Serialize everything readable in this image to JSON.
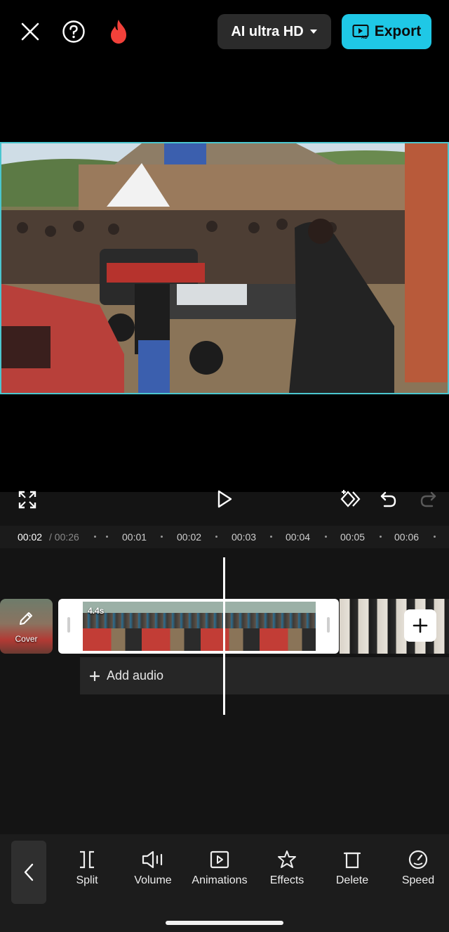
{
  "topbar": {
    "close_icon": "close-icon",
    "help_icon": "help-icon",
    "fire_icon": "fire-icon",
    "quality_label": "AI ultra HD",
    "export_label": "Export",
    "colors": {
      "export_bg": "#1fc8e6",
      "fire": "#f2413a"
    }
  },
  "controls": {
    "fullscreen_icon": "fullscreen-icon",
    "play_icon": "play-icon",
    "keyframe_icon": "add-keyframe-icon",
    "undo_icon": "undo-icon",
    "redo_icon": "redo-icon"
  },
  "ruler": {
    "current_time": "00:02",
    "total_time": "/ 00:26",
    "ticks": [
      "00:01",
      "00:02",
      "00:03",
      "00:04",
      "00:05",
      "00:06"
    ]
  },
  "timeline": {
    "cover_label": "Cover",
    "clip_duration": "4.4s",
    "add_audio_label": "Add audio"
  },
  "toolbar": {
    "items": [
      {
        "label": "Split",
        "icon": "split-icon"
      },
      {
        "label": "Volume",
        "icon": "volume-icon"
      },
      {
        "label": "Animations",
        "icon": "animations-icon"
      },
      {
        "label": "Effects",
        "icon": "effects-icon"
      },
      {
        "label": "Delete",
        "icon": "delete-icon"
      },
      {
        "label": "Speed",
        "icon": "speed-icon"
      }
    ]
  }
}
